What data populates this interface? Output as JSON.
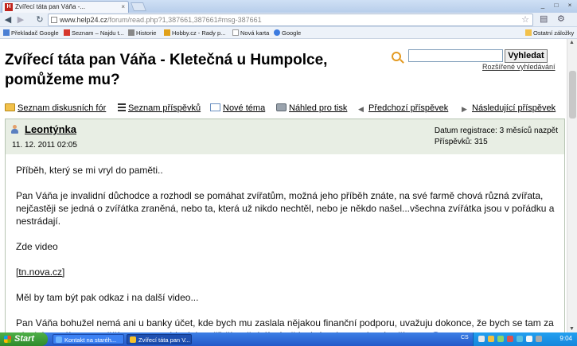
{
  "browser": {
    "tab_title": "Zvířecí táta pan Váňa -...",
    "tab_close": "×",
    "url_host": "www.help24.cz",
    "url_path": "/forum/read.php?1,387661,387661#msg-387661",
    "window_controls": [
      "_",
      "□",
      "×"
    ],
    "bookmarks": [
      {
        "label": "Překladač Google",
        "icon": "translate-icon",
        "color": "#4a7fd4"
      },
      {
        "label": "Seznam – Najdu t...",
        "icon": "seznam-icon",
        "color": "#d6372d"
      },
      {
        "label": "Historie",
        "icon": "history-icon",
        "color": "#888888"
      },
      {
        "label": "Hobby.cz - Rady p...",
        "icon": "hobby-icon",
        "color": "#e0a11b"
      },
      {
        "label": "Nová karta",
        "icon": "page-icon",
        "color": "#cccccc"
      },
      {
        "label": "Google",
        "icon": "google-icon",
        "color": "#3c7be0"
      }
    ],
    "other_bookmarks": "Ostatní záložky"
  },
  "page": {
    "title": "Zvířecí táta pan Váňa - Kletečná u Humpolce, pomůžeme mu?",
    "search": {
      "button": "Vyhledat",
      "advanced": "Rozšířené vyhledávání",
      "value": ""
    },
    "nav": [
      {
        "label": "Seznam diskusních fór",
        "icon": "folder-icon"
      },
      {
        "label": "Seznam příspěvků",
        "icon": "list-icon"
      },
      {
        "label": "Nové téma",
        "icon": "new-topic-icon"
      },
      {
        "label": "Náhled pro tisk",
        "icon": "print-icon"
      },
      {
        "label": "Předchozí příspěvek",
        "icon": "arrow-left-icon"
      },
      {
        "label": "Následující příspěvek",
        "icon": "arrow-right-icon"
      }
    ],
    "post": {
      "author": "Leontýnka",
      "date": "11. 12. 2011 02:05",
      "registration": "Datum registrace: 3 měsíců nazpět",
      "posts": "Příspěvků: 315",
      "paragraphs": [
        "Příběh, který se mi vryl do paměti..",
        "Pan Váňa je invalidní důchodce a rozhodl se pomáhat zvířatům, možná jeho příběh znáte, na své farmě chová různá zvířata, nejčastěji se jedná o zvířátka zraněná, nebo ta, která už nikdo nechtěl, nebo je někdo našel...všechna zvířátka jsou v pořádku a nestrádají.",
        "Zde video",
        "tn.nova.cz",
        "Měl by tam být pak odkaz i na další video...",
        "Pan Váňa bohužel nemá ani u banky účet, kde bych mu zaslala nějakou finanční podporu, uvažuju dokonce, že bych se tam za ním jela podívat a s něčím mu pomohla, jeho příběh mě dojímá až k slzám, jsem taková měkota..."
      ]
    }
  },
  "taskbar": {
    "start": "Start",
    "tasks": [
      "Kontakt na staréh...",
      "Zvířecí táta pan V..."
    ],
    "lang": "CS",
    "clock": "9:04"
  }
}
